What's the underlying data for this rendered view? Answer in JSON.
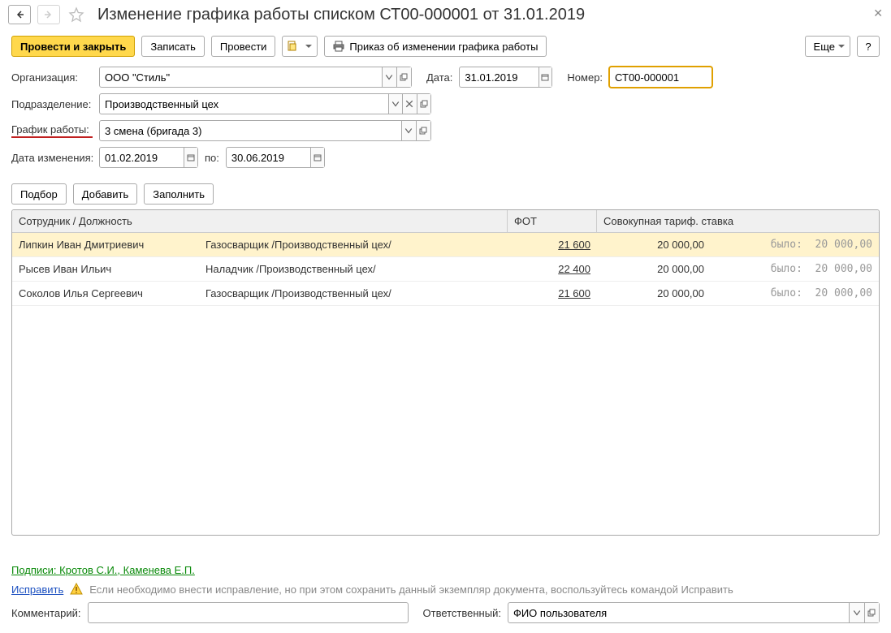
{
  "title": "Изменение графика работы списком СТ00-000001 от 31.01.2019",
  "toolbar": {
    "post_close": "Провести и закрыть",
    "save": "Записать",
    "post": "Провести",
    "print": "Приказ об изменении графика работы",
    "more": "Еще",
    "help": "?"
  },
  "fields": {
    "org_label": "Организация:",
    "org_value": "ООО \"Стиль\"",
    "date_label": "Дата:",
    "date_value": "31.01.2019",
    "number_label": "Номер:",
    "number_value": "СТ00-000001",
    "dept_label": "Подразделение:",
    "dept_value": "Производственный цех",
    "schedule_label": "График работы:",
    "schedule_value": "3 смена (бригада 3)",
    "change_date_label": "Дата изменения:",
    "change_from": "01.02.2019",
    "to_label": "по:",
    "change_to": "30.06.2019"
  },
  "table_btns": {
    "select": "Подбор",
    "add": "Добавить",
    "fill": "Заполнить"
  },
  "table": {
    "head": {
      "employee": "Сотрудник / Должность",
      "fot": "ФОТ",
      "rate": "Совокупная тариф. ставка"
    },
    "was_label": "было:",
    "rows": [
      {
        "emp": "Липкин Иван Дмитриевич",
        "pos": "Газосварщик /Производственный цех/",
        "fot": "21 600",
        "rate": "20 000,00",
        "was": "20 000,00",
        "sel": true
      },
      {
        "emp": "Рысев Иван Ильич",
        "pos": "Наладчик /Производственный цех/",
        "fot": "22 400",
        "rate": "20 000,00",
        "was": "20 000,00",
        "sel": false
      },
      {
        "emp": "Соколов Илья Сергеевич",
        "pos": "Газосварщик /Производственный цех/",
        "fot": "21 600",
        "rate": "20 000,00",
        "was": "20 000,00",
        "sel": false
      }
    ]
  },
  "footer": {
    "signatures": "Подписи: Кротов С.И., Каменева Е.П.",
    "fix": "Исправить",
    "hint": "Если необходимо внести исправление, но при этом сохранить данный экземпляр документа, воспользуйтесь командой Исправить",
    "comment_label": "Комментарий:",
    "comment_value": "",
    "resp_label": "Ответственный:",
    "resp_value": "ФИО пользователя"
  }
}
